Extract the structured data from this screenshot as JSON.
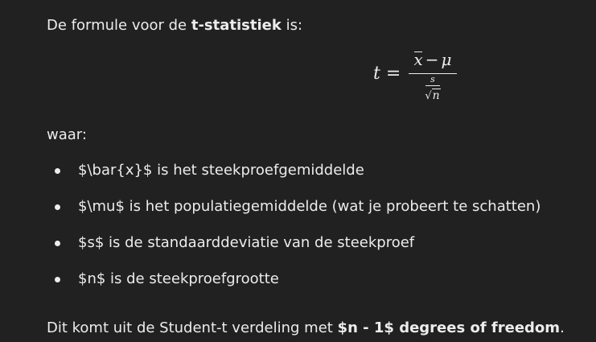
{
  "intro": {
    "prefix": "De formule voor de ",
    "term": "t-statistiek",
    "suffix": " is:"
  },
  "formula": {
    "lhs": "t =",
    "numerator_var": "x",
    "minus": "−",
    "mu": "μ",
    "denominator_top": "s",
    "denominator_radical": "√",
    "denominator_under": "n"
  },
  "waar_label": "waar:",
  "bullets": [
    "$\\bar{x}$ is het steekproefgemiddelde",
    "$\\mu$ is het populatiegemiddelde (wat je probeert te schatten)",
    "$s$ is de standaarddeviatie van de steekproef",
    "$n$ is de steekproefgrootte"
  ],
  "outro": {
    "prefix": "Dit komt uit de Student-t verdeling met ",
    "bold": "$n - 1$ degrees of freedom",
    "suffix": "."
  },
  "colors": {
    "background": "#212121",
    "text": "#ececec"
  }
}
